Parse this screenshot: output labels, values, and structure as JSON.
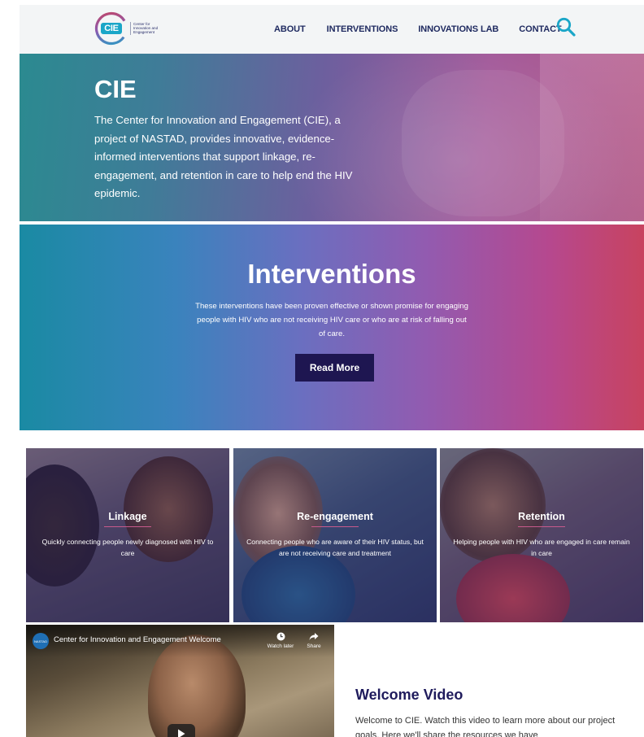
{
  "header": {
    "logo": {
      "acronym": "CIE",
      "line1": "Center for",
      "line2": "Innovation and",
      "line3": "Engagement"
    },
    "nav": [
      "ABOUT",
      "INTERVENTIONS",
      "INNOVATIONS LAB",
      "CONTACT"
    ],
    "search_icon": "search-icon"
  },
  "hero": {
    "title": "CIE",
    "text": "The Center for Innovation and Engagement (CIE), a project of NASTAD, provides innovative, evidence-informed interventions that support linkage, re-engagement, and retention in care to help end the HIV epidemic."
  },
  "interventions": {
    "title": "Interventions",
    "text": "These interventions have been proven effective or shown promise for engaging people with HIV who are not receiving HIV care or who are at risk of falling out of care.",
    "button": "Read More"
  },
  "cards": [
    {
      "title": "Linkage",
      "desc": "Quickly connecting people newly diagnosed with HIV to care"
    },
    {
      "title": "Re-engagement",
      "desc": "Connecting people who are aware of their HIV status, but are not receiving care and treatment"
    },
    {
      "title": "Retention",
      "desc": "Helping people with HIV who are engaged in care remain in care"
    }
  ],
  "video": {
    "channel_badge": "NASTAD",
    "title": "Center for Innovation and Engagement Welcome",
    "watch_later": "Watch later",
    "share": "Share"
  },
  "welcome": {
    "title": "Welcome Video",
    "text": "Welcome to CIE. Watch this video to learn more about our project goals. Here we'll share the resources we have"
  },
  "colors": {
    "navy": "#1f2a60",
    "button": "#1e1651",
    "accent_teal": "#1aa6c8",
    "accent_pink": "#c8435f"
  }
}
